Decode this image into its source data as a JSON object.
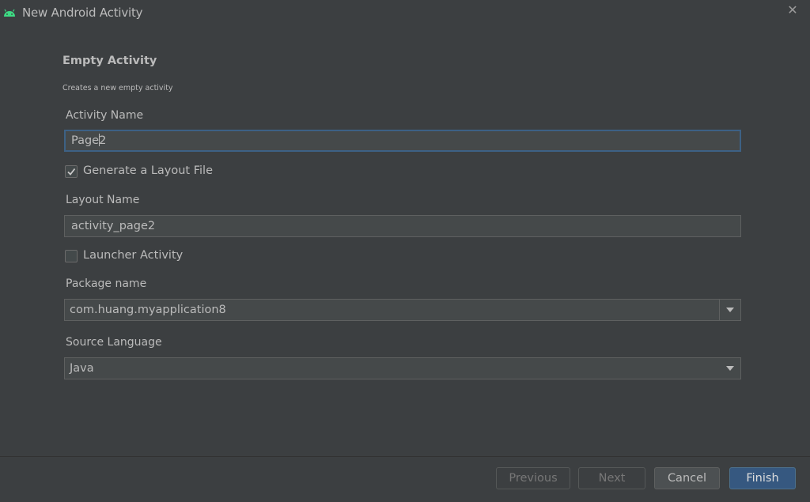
{
  "window": {
    "title": "New Android Activity",
    "icon": "android-icon",
    "accent_color": "#3ddc84"
  },
  "header": {
    "heading": "Empty Activity",
    "description": "Creates a new empty activity"
  },
  "form": {
    "activity_name": {
      "label": "Activity Name",
      "value": "Page2"
    },
    "generate_layout": {
      "label": "Generate a Layout File",
      "checked": true
    },
    "layout_name": {
      "label": "Layout Name",
      "value": "activity_page2"
    },
    "launcher_activity": {
      "label": "Launcher Activity",
      "checked": false
    },
    "package_name": {
      "label": "Package name",
      "value": "com.huang.myapplication8"
    },
    "source_language": {
      "label": "Source Language",
      "value": "Java"
    }
  },
  "footer": {
    "previous_label": "Previous",
    "next_label": "Next",
    "cancel_label": "Cancel",
    "finish_label": "Finish",
    "primary_color": "#365880"
  }
}
